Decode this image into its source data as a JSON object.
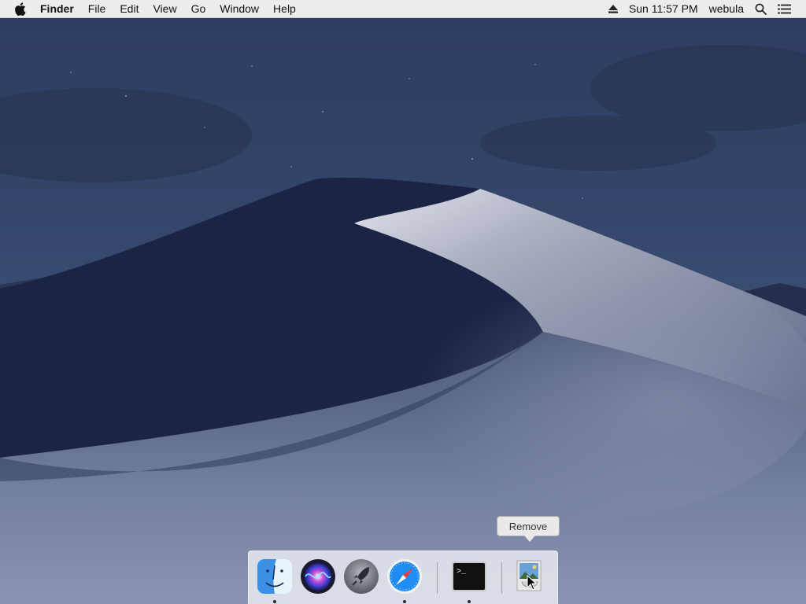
{
  "menubar": {
    "apple_icon": "apple-icon",
    "app_name": "Finder",
    "menus": [
      "File",
      "Edit",
      "View",
      "Go",
      "Window",
      "Help"
    ],
    "eject_icon": "eject-icon",
    "clock": "Sun 11:57 PM",
    "user": "webula",
    "spotlight_icon": "search-icon",
    "notification_icon": "list-icon"
  },
  "dock": {
    "apps": [
      {
        "name": "Finder",
        "icon": "finder-icon",
        "running": true
      },
      {
        "name": "Siri",
        "icon": "siri-icon",
        "running": false
      },
      {
        "name": "Launchpad",
        "icon": "launchpad-icon",
        "running": false
      },
      {
        "name": "Safari",
        "icon": "safari-icon",
        "running": true
      },
      {
        "name": "Terminal",
        "icon": "terminal-icon",
        "running": true
      },
      {
        "name": "Preview",
        "icon": "preview-icon",
        "running": false
      }
    ],
    "terminal_prompt": ">_"
  },
  "tooltip": {
    "text": "Remove"
  },
  "colors": {
    "sky": "#2c3b5e",
    "dune_dark": "#1d2746",
    "dune_light": "#c9ccd6",
    "menubar": "#f6f6f6"
  }
}
